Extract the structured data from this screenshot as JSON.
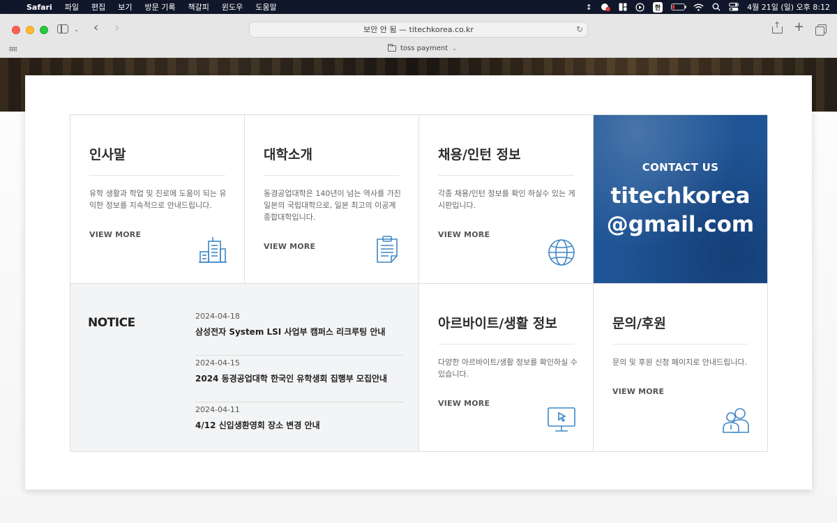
{
  "menubar": {
    "app": "Safari",
    "items": [
      "파일",
      "편집",
      "보기",
      "방문 기록",
      "책갈피",
      "윈도우",
      "도움말"
    ],
    "ime": "한",
    "clock": "4월 21일 (일) 오후 8:12"
  },
  "browser": {
    "address": "보안 안 됨 — titechkorea.co.kr",
    "bookmark_folder": "toss payment"
  },
  "cards": {
    "greeting": {
      "title": "인사말",
      "desc": "유학 생활과 학업 및 진로에 도움이 되는 유익한 정보를 지속적으로 안내드립니다.",
      "more": "VIEW MORE"
    },
    "university": {
      "title": "대학소개",
      "desc": "동경공업대학은 140년이 넘는 역사를 가진 일본의 국립대학으로, 일본 최고의 이공계 종합대학입니다.",
      "more": "VIEW MORE"
    },
    "jobs": {
      "title": "채용/인턴 정보",
      "desc": "각종 채용/인턴 정보를 확인 하실수 있는 게시판입니다.",
      "more": "VIEW MORE"
    },
    "parttime": {
      "title": "아르바이트/생활 정보",
      "desc": "다양한 아르바이트/생활 정보를 확인하실 수 있습니다.",
      "more": "VIEW MORE"
    },
    "inquiry": {
      "title": "문의/후원",
      "desc": "문의 및 후원 신청 페이지로 안내드립니다.",
      "more": "VIEW MORE"
    }
  },
  "contact": {
    "label": "CONTACT US",
    "email_line1": "titechkorea",
    "email_line2": "@gmail.com",
    "bg_color": "#1f5596"
  },
  "notice": {
    "title": "NOTICE",
    "items": [
      {
        "date": "2024-04-18",
        "text": "삼성전자 System LSI 사업부 캠퍼스 리크루팅 안내"
      },
      {
        "date": "2024-04-15",
        "text": "2024 동경공업대학 한국인 유학생회 집행부 모집안내"
      },
      {
        "date": "2024-04-11",
        "text": "4/12 신입생환영회 장소 변경 안내"
      }
    ]
  },
  "icons": {
    "greeting": "building-icon",
    "university": "clipboard-icon",
    "jobs": "globe-icon",
    "parttime": "monitor-icon",
    "inquiry": "people-icon",
    "accent_color": "#3d86c6"
  }
}
